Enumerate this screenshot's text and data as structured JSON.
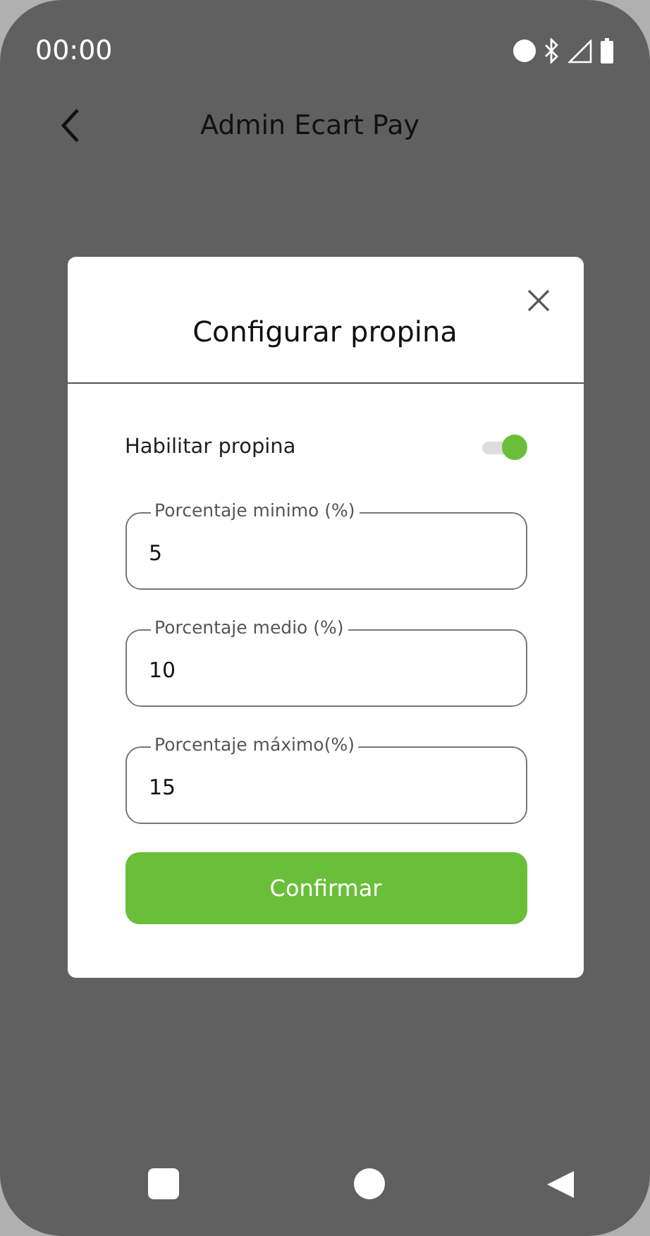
{
  "status_bar": {
    "time": "00:00"
  },
  "app_bar": {
    "title": "Admin Ecart Pay"
  },
  "dialog": {
    "title": "Configurar propina",
    "toggle": {
      "label": "Habilitar propina",
      "on": true
    },
    "fields": [
      {
        "label": "Porcentaje minimo (%)",
        "value": "5"
      },
      {
        "label": "Porcentaje medio (%)",
        "value": "10"
      },
      {
        "label": "Porcentaje máximo(%)",
        "value": "15"
      }
    ],
    "button": "Confirmar"
  }
}
